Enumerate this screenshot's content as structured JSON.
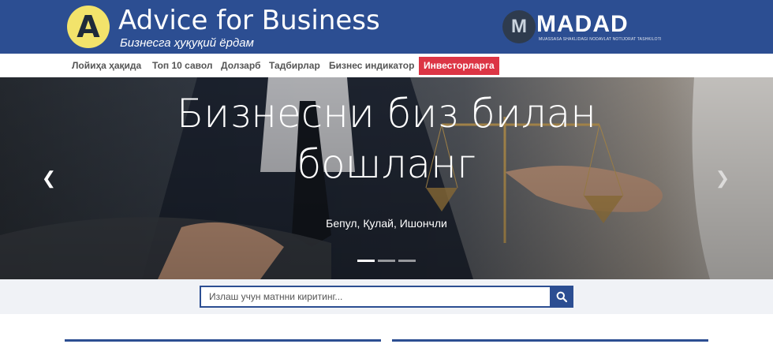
{
  "header": {
    "logo_letter": "A",
    "brand_title": "Advice for Business",
    "brand_subtitle": "Бизнесга ҳуқуқий ёрдам",
    "partner": {
      "mark": "M",
      "name": "MADAD",
      "subtitle": "MUASSASA SHAKLIDAGI NODAVLAT NOTIJORAT TASHKILOTI"
    }
  },
  "nav": {
    "items": [
      {
        "label": "Лойиҳа ҳақида"
      },
      {
        "label": "Топ 10 савол"
      },
      {
        "label": "Долзарб"
      },
      {
        "label": "Тадбирлар"
      },
      {
        "label": "Бизнес индикатор"
      },
      {
        "label": "Инвесторларга",
        "active": true
      }
    ]
  },
  "hero": {
    "title_line1": "Бизнесни биз билан",
    "title_line2": "бошланг",
    "subtitle": "Бепул, Қулай, Ишончли",
    "slide_count": 3,
    "active_slide": 1
  },
  "search": {
    "placeholder": "Излаш учун матнни киритинг..."
  },
  "colors": {
    "brand_blue": "#2c4e92",
    "accent_red": "#dc3545",
    "logo_yellow": "#f2e36b"
  }
}
